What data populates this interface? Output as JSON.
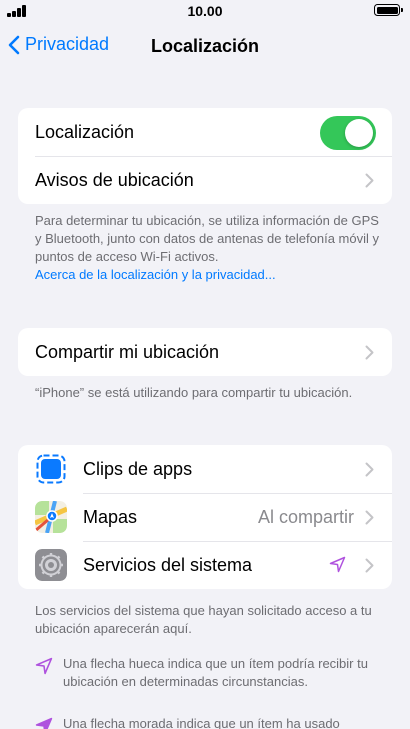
{
  "status_bar": {
    "time": "10.00"
  },
  "nav": {
    "back_label": "Privacidad",
    "title": "Localización"
  },
  "group_location": {
    "toggle_label": "Localización",
    "toggle_on": true,
    "alerts_label": "Avisos de ubicación"
  },
  "location_footnote": {
    "text": "Para determinar tu ubicación, se utiliza información de GPS y Bluetooth, junto con datos de antenas de telefonía móvil y puntos de acceso Wi-Fi activos.",
    "link": "Acerca de la localización y la privacidad..."
  },
  "share": {
    "label": "Compartir mi ubicación",
    "footnote": "“iPhone” se está utilizando para compartir tu ubicación."
  },
  "apps": [
    {
      "label": "Clips de apps",
      "icon": "app-clips-icon",
      "value": ""
    },
    {
      "label": "Mapas",
      "icon": "maps-icon",
      "value": "Al compartir"
    },
    {
      "label": "Servicios del sistema",
      "icon": "settings-gear-icon",
      "value": ""
    }
  ],
  "system_footnote": "Los servicios del sistema que hayan solicitado acceso a tu ubicación aparecerán aquí.",
  "legend": [
    {
      "icon": "hollow-arrow-icon",
      "text": "Una flecha hueca indica que un ítem podría recibir tu ubicación en determinadas circunstancias."
    },
    {
      "icon": "purple-arrow-icon",
      "text": "Una flecha morada indica que un ítem ha usado"
    }
  ],
  "colors": {
    "accent": "#007aff",
    "toggle_on": "#34c759",
    "location_arrow": "#af52de",
    "background": "#f2f2f7"
  }
}
